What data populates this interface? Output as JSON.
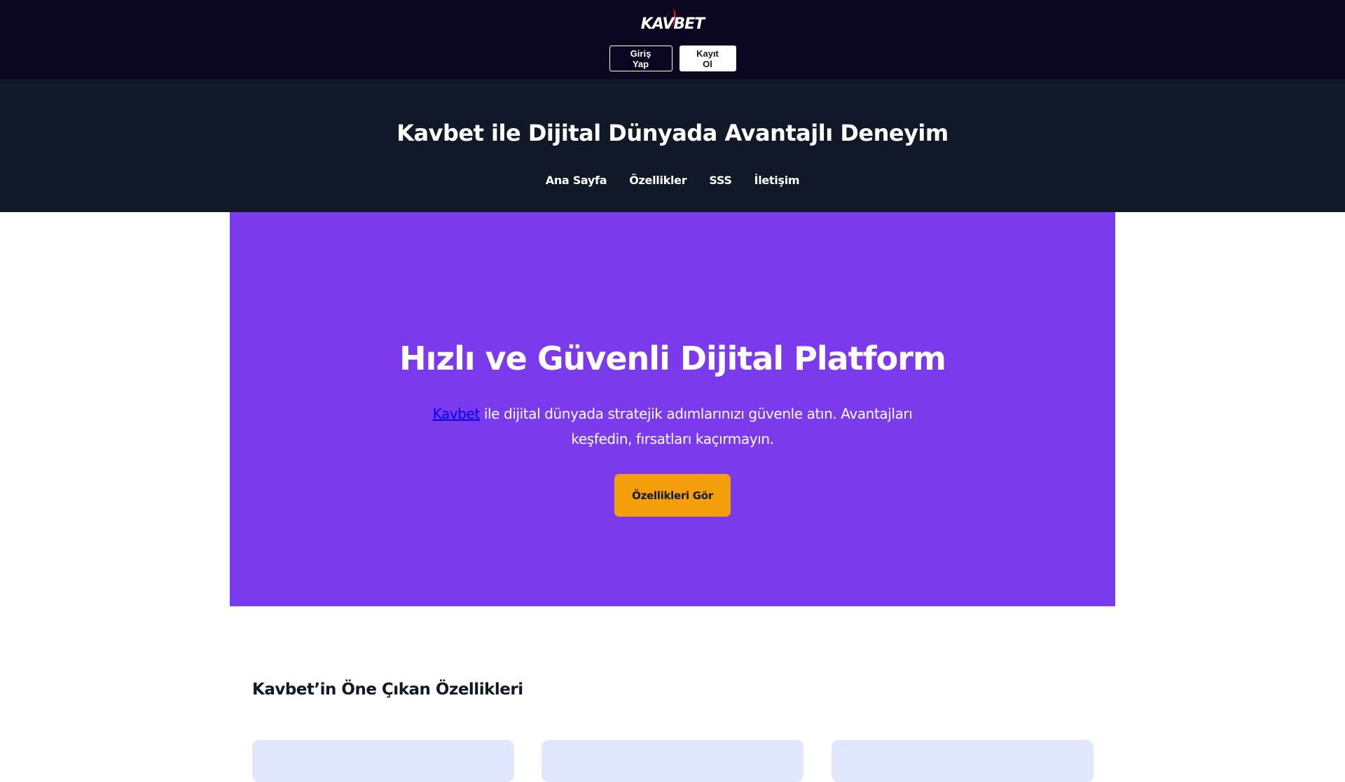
{
  "header": {
    "logo_text": "KAVBET",
    "login_label": "Giriş Yap",
    "register_label": "Kayıt Ol"
  },
  "subheader": {
    "title": "Kavbet ile Dijital Dünyada Avantajlı Deneyim",
    "nav": [
      "Ana Sayfa",
      "Özellikler",
      "SSS",
      "İletişim"
    ]
  },
  "hero": {
    "title": "Hızlı ve Güvenli Dijital Platform",
    "link_text": "Kavbet",
    "text_rest": " ile dijital dünyada stratejik adımlarınızı güvenle atın. Avantajları keşfedin, fırsatları kaçırmayın.",
    "cta_label": "Özellikleri Gör"
  },
  "features": {
    "title": "Kavbet’in Öne Çıkan Özellikleri"
  },
  "colors": {
    "topbar": "#0a061f",
    "subheader": "#111827",
    "hero": "#7c3aed",
    "cta": "#f59e0b",
    "card": "#e0e7ff",
    "logo_accent": "#e11d2e"
  }
}
